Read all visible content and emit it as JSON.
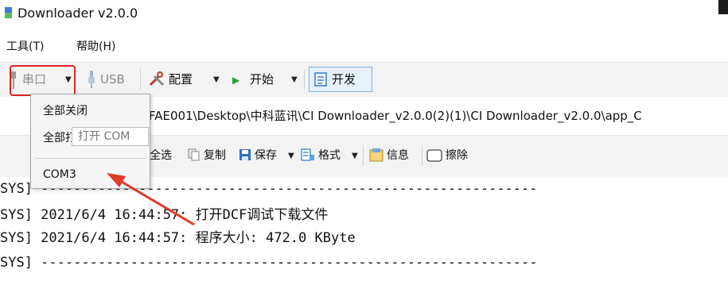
{
  "window": {
    "title": "Downloader v2.0.0"
  },
  "menu": {
    "tools": "工具(T)",
    "help": "帮助(H)"
  },
  "toolbar": {
    "serial": "串口",
    "usb": "USB",
    "config": "配置",
    "start": "开始",
    "develop": "开发"
  },
  "path": {
    "text": "FAE001\\Desktop\\中科蓝讯\\CI Downloader_v2.0.0(2)(1)\\CI Downloader_v2.0.0\\app_C"
  },
  "toolbar2": {
    "select_all": "全选",
    "copy": "复制",
    "save": "保存",
    "format": "格式",
    "info": "信息",
    "erase": "擦除"
  },
  "dropdown": {
    "items": [
      "全部关闭",
      "全部打开",
      "COM3"
    ],
    "tooltip": "打开 COM"
  },
  "log": {
    "lines": [
      "SYS] -------------------------------------------------------------",
      "SYS] 2021/6/4 16:44:57: 打开DCF调试下载文件",
      "SYS] 2021/6/4 16:44:57: 程序大小: 472.0 KByte",
      "SYS] -------------------------------------------------------------"
    ]
  },
  "colors": {
    "highlight_red": "#e02222",
    "arrow_red": "#e03a2a",
    "accent_blue": "#2b79c9"
  }
}
